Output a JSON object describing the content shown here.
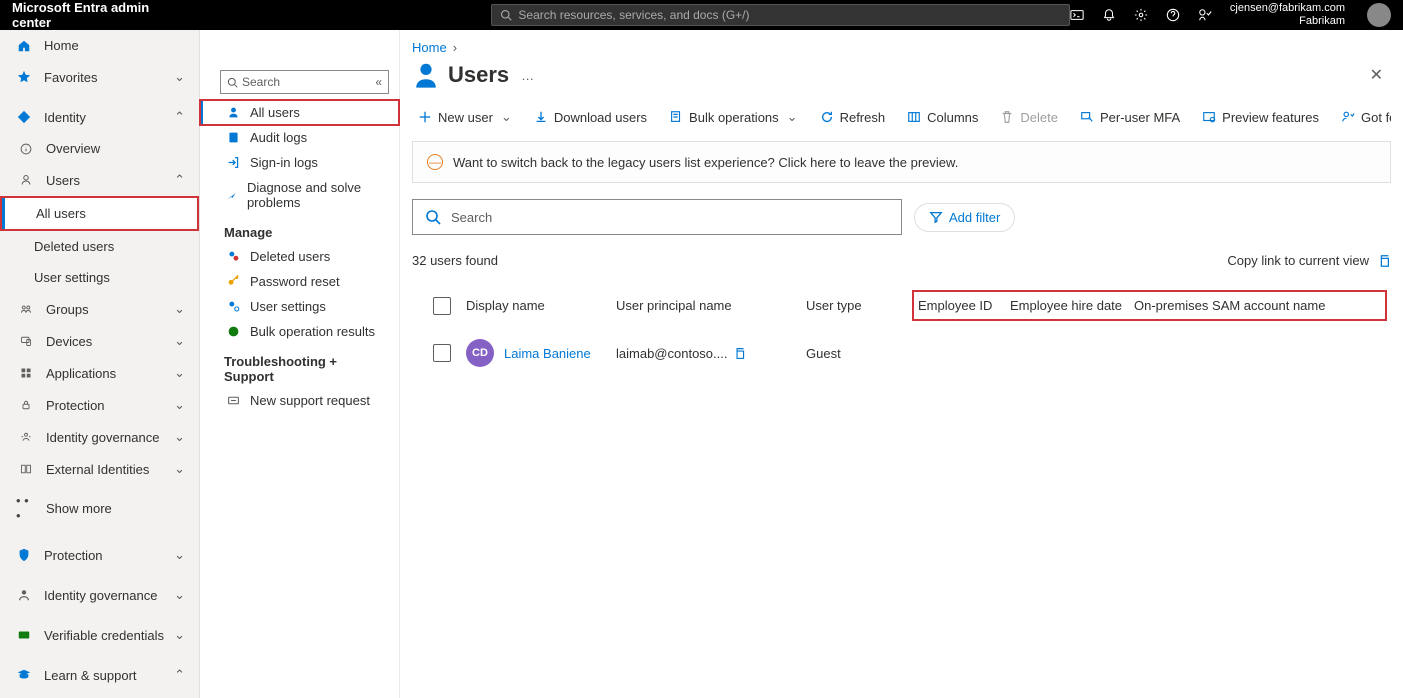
{
  "brand": "Microsoft Entra admin center",
  "top_search_placeholder": "Search resources, services, and docs (G+/)",
  "top_user": {
    "email": "cjensen@fabrikam.com",
    "tenant": "Fabrikam"
  },
  "sidebar": {
    "home": "Home",
    "favorites": "Favorites",
    "identity": "Identity",
    "overview": "Overview",
    "users": "Users",
    "all_users": "All users",
    "deleted_users": "Deleted users",
    "user_settings": "User settings",
    "groups": "Groups",
    "devices": "Devices",
    "applications": "Applications",
    "protection": "Protection",
    "identity_governance": "Identity governance",
    "external_identities": "External Identities",
    "show_more": "Show more",
    "protection2": "Protection",
    "identity_governance2": "Identity governance",
    "verifiable_credentials": "Verifiable credentials",
    "learn_support": "Learn & support"
  },
  "subnav": {
    "search_placeholder": "Search",
    "all_users": "All users",
    "audit_logs": "Audit logs",
    "signin_logs": "Sign-in logs",
    "diagnose": "Diagnose and solve problems",
    "manage": "Manage",
    "deleted_users": "Deleted users",
    "password_reset": "Password reset",
    "user_settings": "User settings",
    "bulk_results": "Bulk operation results",
    "troubleshoot": "Troubleshooting + Support",
    "new_support": "New support request"
  },
  "breadcrumb": {
    "home": "Home"
  },
  "page": {
    "title": "Users"
  },
  "toolbar": {
    "new_user": "New user",
    "download": "Download users",
    "bulk": "Bulk operations",
    "refresh": "Refresh",
    "columns": "Columns",
    "delete": "Delete",
    "mfa": "Per-user MFA",
    "preview": "Preview features",
    "feedback": "Got feedback"
  },
  "banner": "Want to switch back to the legacy users list experience? Click here to leave the preview.",
  "list_search_placeholder": "Search",
  "add_filter": "Add filter",
  "count_text": "32 users found",
  "copy_link": "Copy link to current view",
  "columns": {
    "display_name": "Display name",
    "upn": "User principal name",
    "user_type": "User type",
    "employee_id": "Employee ID",
    "hire_date": "Employee hire date",
    "sam": "On-premises SAM account name"
  },
  "rows": [
    {
      "avatar": "CD",
      "name": "Laima Baniene",
      "upn": "laimab@contoso....",
      "type": "Guest"
    }
  ]
}
